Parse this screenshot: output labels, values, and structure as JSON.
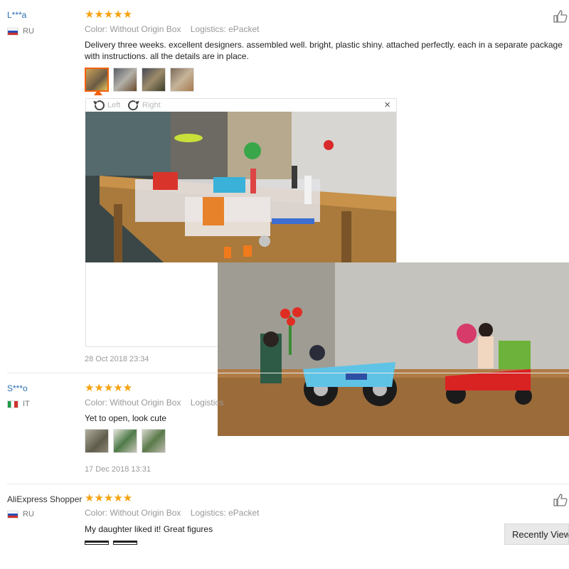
{
  "reviews": [
    {
      "user": "L***a",
      "country": "RU",
      "stars": "★★★★★",
      "color": "Color: Without Origin Box",
      "logistics": "Logistics: ePacket",
      "text": "Delivery three weeks. excellent designers. assembled well. bright, plastic shiny. attached perfectly. each in a separate package with instructions. all the details are in place.",
      "date": "28 Oct 2018 23:34",
      "photo_count": 4
    },
    {
      "user": "S***o",
      "country": "IT",
      "stars": "★★★★★",
      "color": "Color: Without Origin Box",
      "logistics": "Logistics",
      "text": "Yet to open, look cute",
      "date": "17 Dec 2018 13:31",
      "photo_count": 3
    },
    {
      "user": "AliExpress Shopper",
      "country": "RU",
      "stars": "★★★★★",
      "color": "Color: Without Origin Box",
      "logistics": "Logistics: ePacket",
      "text": "My daughter liked it! Great figures",
      "photo_count": 2
    }
  ],
  "viewer": {
    "rotate_left": "Left",
    "rotate_right": "Right",
    "close": "×"
  },
  "recently_viewed": "Recently Viewed",
  "colors": {
    "star": "#f6a20f",
    "user_link": "#2b6db0",
    "active_thumb": "#f2610b"
  }
}
